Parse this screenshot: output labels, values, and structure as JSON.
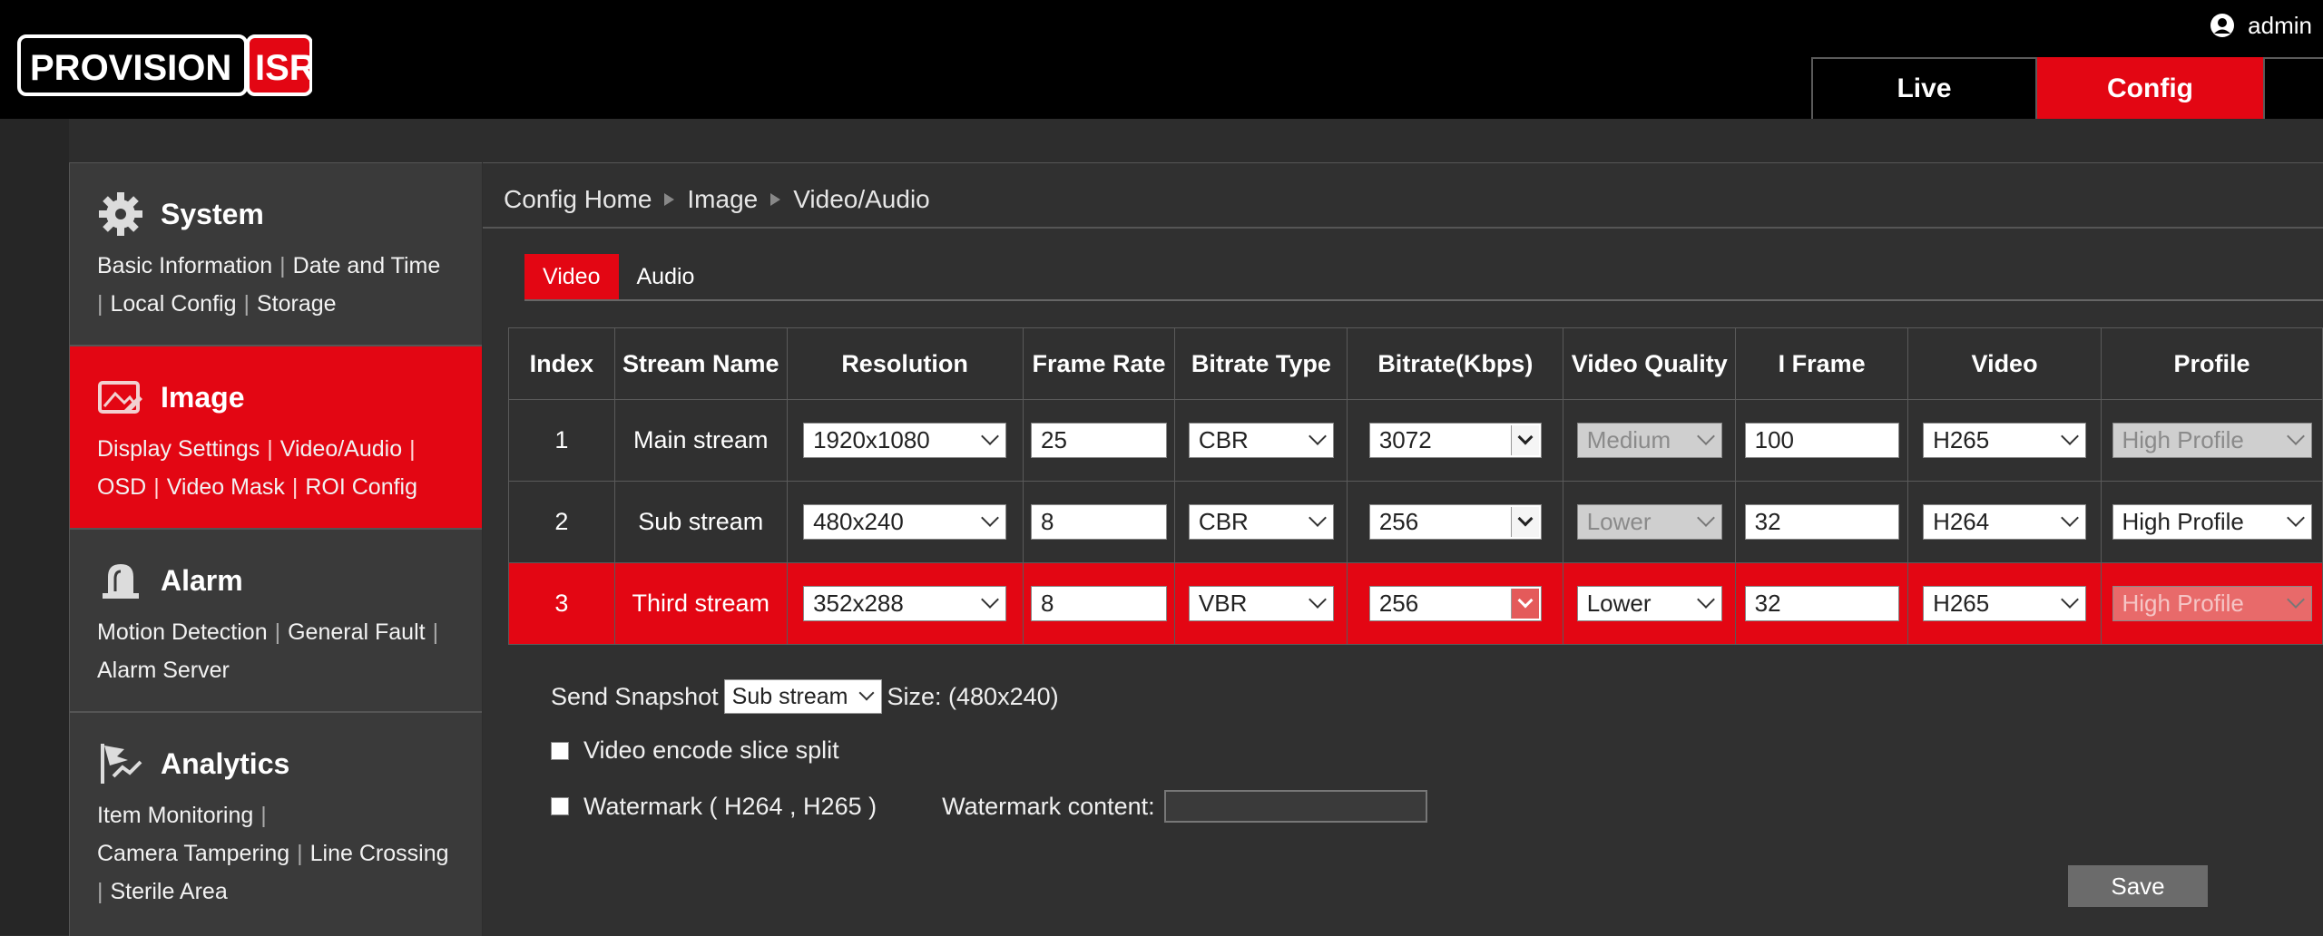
{
  "header": {
    "user": "admin",
    "nav": [
      {
        "label": "Live",
        "active": false
      },
      {
        "label": "Config",
        "active": true
      }
    ]
  },
  "sidebar": {
    "sections": [
      {
        "title": "System",
        "icon": "gear-icon",
        "active": false,
        "links": [
          "Basic Information",
          "Date and Time",
          "Local Config",
          "Storage"
        ]
      },
      {
        "title": "Image",
        "icon": "image-icon",
        "active": true,
        "links": [
          "Display Settings",
          "Video/Audio",
          "OSD",
          "Video Mask",
          "ROI Config"
        ]
      },
      {
        "title": "Alarm",
        "icon": "alarm-bell-icon",
        "active": false,
        "links": [
          "Motion Detection",
          "General Fault",
          "Alarm Server"
        ]
      },
      {
        "title": "Analytics",
        "icon": "analytics-icon",
        "active": false,
        "links": [
          "Item Monitoring",
          "Camera Tampering",
          "Line Crossing",
          "Sterile Area"
        ]
      }
    ]
  },
  "breadcrumb": [
    "Config Home",
    "Image",
    "Video/Audio"
  ],
  "tabs": [
    {
      "label": "Video",
      "active": true
    },
    {
      "label": "Audio",
      "active": false
    }
  ],
  "table": {
    "headers": [
      "Index",
      "Stream Name",
      "Resolution",
      "Frame Rate",
      "Bitrate Type",
      "Bitrate(Kbps)",
      "Video Quality",
      "I Frame",
      "Video",
      "Profile"
    ],
    "rows": [
      {
        "index": "1",
        "name": "Main stream",
        "resolution": "1920x1080",
        "frame_rate": "25",
        "bitrate_type": "CBR",
        "bitrate": "3072",
        "quality": "Medium",
        "iframe": "100",
        "video": "H265",
        "profile": "High Profile"
      },
      {
        "index": "2",
        "name": "Sub stream",
        "resolution": "480x240",
        "frame_rate": "8",
        "bitrate_type": "CBR",
        "bitrate": "256",
        "quality": "Lower",
        "iframe": "32",
        "video": "H264",
        "profile": "High Profile"
      },
      {
        "index": "3",
        "name": "Third stream",
        "resolution": "352x288",
        "frame_rate": "8",
        "bitrate_type": "VBR",
        "bitrate": "256",
        "quality": "Lower",
        "iframe": "32",
        "video": "H265",
        "profile": "High Profile"
      }
    ]
  },
  "snapshot": {
    "label": "Send Snapshot",
    "value": "Sub stream",
    "size_text": "Size: (480x240)"
  },
  "options": {
    "slice_split": "Video encode slice split",
    "watermark": "Watermark ( H264 , H265 )",
    "watermark_content": "Watermark content:"
  },
  "save_label": "Save",
  "colors": {
    "accent": "#e30613",
    "header_bg": "#000000",
    "panel_bg": "#303030"
  }
}
